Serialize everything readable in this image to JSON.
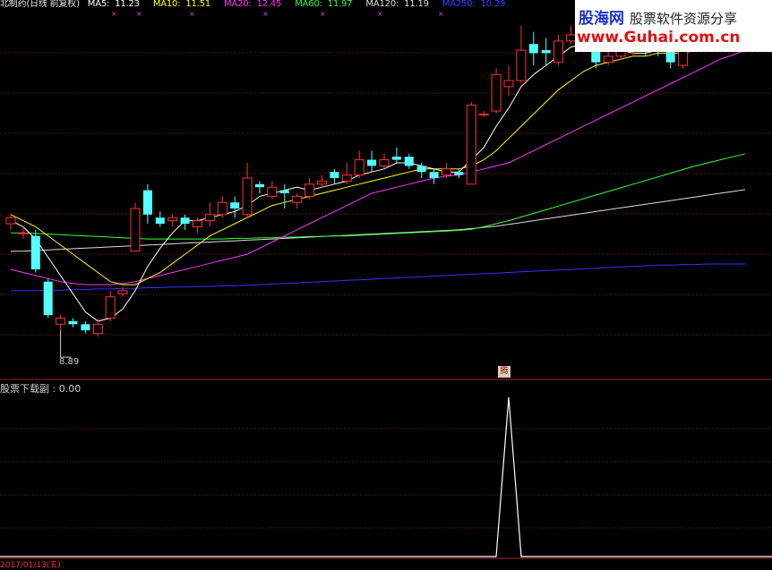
{
  "legend": {
    "title": "北制药(日线 前复权)",
    "items": [
      {
        "label": "MA5:",
        "value": "11.23",
        "color": "#ffffff"
      },
      {
        "label": "MA10:",
        "value": "11.51",
        "color": "#ffff00"
      },
      {
        "label": "MA20:",
        "value": "12.45",
        "color": "#ff33ff"
      },
      {
        "label": "MA60:",
        "value": "11.97",
        "color": "#33ff33"
      },
      {
        "label": "MA120:",
        "value": "11.19",
        "color": "#dddddd"
      },
      {
        "label": "MA250:",
        "value": "10.29",
        "color": "#3333ff"
      }
    ]
  },
  "low_label": "8.89",
  "signal_badge": "腾",
  "sub_indicator": {
    "title": "股票下载副 : 0.00"
  },
  "date_bar": "2017/01/13(五)",
  "watermark": {
    "brand": "股海网",
    "slogan": "股票软件资源分享",
    "url": "www.Guhai.com.cn"
  },
  "colors": {
    "up": "#ff3232",
    "down": "#54ffff",
    "grid": "#7a1a1a",
    "ma5": "#ffffff",
    "ma10": "#ffff00",
    "ma20": "#ff33ff",
    "ma60": "#33ff33",
    "ma120": "#dddddd",
    "ma250": "#3333ff"
  },
  "chart_data": {
    "type": "candlestick",
    "yrange": [
      8.6,
      14.3
    ],
    "candles": [
      [
        10.95,
        11.05,
        10.85,
        11.1
      ],
      [
        10.8,
        10.8,
        10.7,
        10.9
      ],
      [
        10.75,
        10.2,
        10.15,
        10.85
      ],
      [
        10.0,
        9.45,
        9.4,
        10.05
      ],
      [
        9.3,
        9.4,
        9.2,
        9.45
      ],
      [
        9.35,
        9.3,
        9.25,
        9.4
      ],
      [
        9.3,
        9.2,
        9.15,
        9.35
      ],
      [
        9.15,
        9.3,
        9.1,
        9.4
      ],
      [
        9.4,
        9.75,
        9.35,
        9.85
      ],
      [
        9.8,
        9.85,
        9.75,
        9.9
      ],
      [
        10.5,
        11.2,
        10.5,
        11.3
      ],
      [
        11.5,
        11.1,
        10.95,
        11.6
      ],
      [
        11.05,
        10.95,
        10.9,
        11.15
      ],
      [
        11.0,
        11.05,
        10.9,
        11.1
      ],
      [
        11.05,
        10.95,
        10.85,
        11.1
      ],
      [
        10.9,
        11.0,
        10.8,
        11.05
      ],
      [
        11.0,
        11.1,
        10.9,
        11.3
      ],
      [
        11.1,
        11.3,
        11.05,
        11.4
      ],
      [
        11.3,
        11.2,
        11.05,
        11.4
      ],
      [
        11.1,
        11.7,
        11.05,
        11.95
      ],
      [
        11.6,
        11.55,
        11.45,
        11.65
      ],
      [
        11.4,
        11.55,
        11.35,
        11.65
      ],
      [
        11.5,
        11.45,
        11.2,
        11.6
      ],
      [
        11.3,
        11.4,
        11.2,
        11.45
      ],
      [
        11.4,
        11.6,
        11.35,
        11.7
      ],
      [
        11.6,
        11.65,
        11.55,
        11.75
      ],
      [
        11.8,
        11.7,
        11.6,
        11.85
      ],
      [
        11.65,
        11.75,
        11.6,
        11.95
      ],
      [
        11.75,
        12.0,
        11.7,
        12.15
      ],
      [
        12.0,
        11.9,
        11.8,
        12.15
      ],
      [
        11.9,
        12.0,
        11.85,
        12.1
      ],
      [
        12.05,
        12.0,
        11.95,
        12.2
      ],
      [
        12.05,
        11.9,
        11.85,
        12.1
      ],
      [
        11.9,
        11.8,
        11.7,
        11.95
      ],
      [
        11.8,
        11.7,
        11.6,
        11.85
      ],
      [
        11.75,
        11.85,
        11.7,
        11.95
      ],
      [
        11.8,
        11.75,
        11.7,
        11.85
      ],
      [
        11.6,
        12.9,
        11.6,
        12.95
      ],
      [
        12.75,
        12.75,
        12.7,
        12.8
      ],
      [
        12.8,
        13.4,
        12.75,
        13.5
      ],
      [
        13.2,
        13.3,
        13.05,
        13.55
      ],
      [
        13.3,
        13.8,
        13.25,
        14.2
      ],
      [
        13.9,
        13.75,
        13.55,
        14.1
      ],
      [
        13.8,
        13.75,
        13.55,
        14.0
      ],
      [
        13.6,
        13.95,
        13.55,
        14.05
      ],
      [
        13.95,
        14.05,
        13.9,
        14.2
      ],
      [
        14.0,
        14.1,
        13.95,
        14.15
      ],
      [
        14.05,
        13.6,
        13.5,
        14.1
      ],
      [
        13.6,
        13.7,
        13.55,
        13.8
      ],
      [
        13.7,
        13.8,
        13.65,
        13.85
      ],
      [
        13.9,
        14.0,
        13.7,
        14.25
      ],
      [
        14.0,
        13.8,
        13.7,
        14.05
      ],
      [
        13.85,
        13.8,
        13.7,
        13.9
      ],
      [
        13.8,
        13.6,
        13.5,
        13.85
      ],
      [
        13.55,
        13.9,
        13.5,
        14.05
      ],
      [
        14.0,
        14.35,
        13.95,
        14.4
      ],
      [
        14.3,
        14.2,
        13.95,
        14.35
      ],
      [
        14.0,
        14.3,
        13.9,
        14.5
      ],
      [
        14.2,
        14.05,
        13.95,
        14.4
      ],
      [
        14.1,
        14.3,
        14.0,
        14.4
      ]
    ],
    "ma": {
      "ma5": [
        11.0,
        10.9,
        10.7,
        10.4,
        10.1,
        9.8,
        9.5,
        9.35,
        9.4,
        9.55,
        9.85,
        10.25,
        10.55,
        10.8,
        11.0,
        11.0,
        11.05,
        11.1,
        11.15,
        11.25,
        11.4,
        11.45,
        11.5,
        11.55,
        11.5,
        11.55,
        11.6,
        11.65,
        11.75,
        11.8,
        11.85,
        11.95,
        11.95,
        11.9,
        11.85,
        11.8,
        11.8,
        12.0,
        12.2,
        12.55,
        12.85,
        13.2,
        13.4,
        13.55,
        13.7,
        13.85,
        13.9,
        13.85,
        13.8,
        13.8,
        13.75,
        13.75,
        13.8,
        13.8,
        13.8,
        13.9,
        14.0,
        14.05,
        14.1,
        14.15
      ],
      "ma10": [
        11.1,
        11.0,
        10.9,
        10.75,
        10.6,
        10.45,
        10.3,
        10.15,
        10.0,
        9.95,
        9.95,
        10.05,
        10.15,
        10.3,
        10.45,
        10.6,
        10.75,
        10.85,
        10.95,
        11.05,
        11.15,
        11.25,
        11.3,
        11.35,
        11.4,
        11.45,
        11.5,
        11.55,
        11.6,
        11.65,
        11.7,
        11.75,
        11.8,
        11.85,
        11.85,
        11.85,
        11.85,
        11.9,
        12.0,
        12.15,
        12.35,
        12.55,
        12.75,
        12.95,
        13.15,
        13.3,
        13.45,
        13.55,
        13.6,
        13.65,
        13.7,
        13.7,
        13.75,
        13.75,
        13.75,
        13.8,
        13.85,
        13.9,
        13.95,
        14.0
      ],
      "ma20": [
        10.2,
        10.15,
        10.1,
        10.05,
        10.0,
        9.97,
        9.95,
        9.95,
        9.95,
        9.97,
        10.0,
        10.05,
        10.1,
        10.15,
        10.2,
        10.25,
        10.3,
        10.35,
        10.4,
        10.45,
        10.55,
        10.65,
        10.75,
        10.85,
        10.95,
        11.05,
        11.15,
        11.25,
        11.35,
        11.45,
        11.5,
        11.55,
        11.6,
        11.65,
        11.7,
        11.73,
        11.75,
        11.8,
        11.85,
        11.9,
        11.95,
        12.05,
        12.15,
        12.25,
        12.35,
        12.45,
        12.55,
        12.65,
        12.75,
        12.85,
        12.95,
        13.05,
        13.15,
        13.25,
        13.35,
        13.45,
        13.55,
        13.65,
        13.72,
        13.8
      ],
      "ma60": [
        10.8,
        10.8,
        10.79,
        10.78,
        10.77,
        10.76,
        10.75,
        10.74,
        10.73,
        10.72,
        10.71,
        10.7,
        10.7,
        10.7,
        10.7,
        10.7,
        10.7,
        10.7,
        10.71,
        10.71,
        10.72,
        10.72,
        10.73,
        10.73,
        10.74,
        10.74,
        10.75,
        10.75,
        10.76,
        10.77,
        10.78,
        10.79,
        10.8,
        10.81,
        10.82,
        10.83,
        10.84,
        10.86,
        10.9,
        10.95,
        11.0,
        11.06,
        11.12,
        11.18,
        11.24,
        11.3,
        11.36,
        11.42,
        11.48,
        11.54,
        11.6,
        11.66,
        11.72,
        11.78,
        11.84,
        11.9,
        11.95,
        12.0,
        12.05,
        12.1
      ],
      "ma120": [
        10.5,
        10.5,
        10.51,
        10.52,
        10.53,
        10.54,
        10.55,
        10.56,
        10.57,
        10.58,
        10.59,
        10.6,
        10.61,
        10.62,
        10.63,
        10.64,
        10.65,
        10.66,
        10.67,
        10.68,
        10.69,
        10.7,
        10.71,
        10.72,
        10.73,
        10.74,
        10.75,
        10.76,
        10.77,
        10.78,
        10.79,
        10.8,
        10.81,
        10.82,
        10.83,
        10.84,
        10.85,
        10.87,
        10.89,
        10.91,
        10.94,
        10.97,
        11.0,
        11.03,
        11.06,
        11.09,
        11.12,
        11.15,
        11.18,
        11.21,
        11.24,
        11.27,
        11.3,
        11.33,
        11.36,
        11.39,
        11.42,
        11.45,
        11.48,
        11.51
      ],
      "ma250": [
        9.85,
        9.85,
        9.85,
        9.86,
        9.86,
        9.87,
        9.87,
        9.88,
        9.88,
        9.89,
        9.89,
        9.9,
        9.9,
        9.91,
        9.91,
        9.92,
        9.92,
        9.93,
        9.93,
        9.94,
        9.95,
        9.96,
        9.97,
        9.98,
        9.99,
        10.0,
        10.01,
        10.02,
        10.03,
        10.04,
        10.05,
        10.06,
        10.07,
        10.08,
        10.09,
        10.1,
        10.11,
        10.12,
        10.13,
        10.14,
        10.15,
        10.16,
        10.17,
        10.18,
        10.19,
        10.2,
        10.21,
        10.22,
        10.23,
        10.24,
        10.25,
        10.26,
        10.27,
        10.27,
        10.28,
        10.28,
        10.29,
        10.29,
        10.29,
        10.29
      ]
    },
    "low_index": 4,
    "signal": {
      "index": 40,
      "value": 1.0
    },
    "sub_values": "all zero except signal index"
  }
}
